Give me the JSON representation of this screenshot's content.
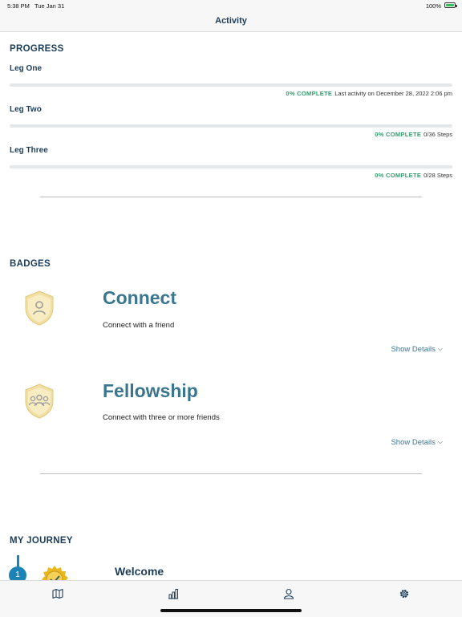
{
  "status_bar": {
    "time": "5:38 PM",
    "date": "Tue Jan 31",
    "battery": "100%"
  },
  "nav": {
    "title": "Activity"
  },
  "progress": {
    "heading": "PROGRESS",
    "legs": [
      {
        "name": "Leg One",
        "percent_label": "0% COMPLETE",
        "detail": "Last activity on December 28, 2022 2:06 pm",
        "progress": 0
      },
      {
        "name": "Leg Two",
        "percent_label": "0% COMPLETE",
        "detail": "0/36 Steps",
        "progress": 0
      },
      {
        "name": "Leg Three",
        "percent_label": "0% COMPLETE",
        "detail": "0/28 Steps",
        "progress": 0
      }
    ]
  },
  "badges": {
    "heading": "BADGES",
    "items": [
      {
        "title": "Connect",
        "description": "Connect with a friend",
        "details_label": "Show Details",
        "icon": "single-person-shield-badge-icon"
      },
      {
        "title": "Fellowship",
        "description": "Connect with three or more friends",
        "details_label": "Show Details",
        "icon": "group-shield-badge-icon"
      }
    ]
  },
  "journey": {
    "heading": "MY JOURNEY",
    "steps": [
      {
        "number": "1",
        "title": "Welcome",
        "icon": "gold-seal-badge-icon"
      }
    ]
  },
  "tab_bar": {
    "tabs": [
      {
        "icon": "map-icon"
      },
      {
        "icon": "bar-chart-icon"
      },
      {
        "icon": "person-icon"
      },
      {
        "icon": "gear-icon"
      }
    ]
  },
  "colors": {
    "navy": "#1c3d5a",
    "teal": "#3a7690",
    "green": "#2f9e6b",
    "journey_blue": "#1b84b5"
  }
}
